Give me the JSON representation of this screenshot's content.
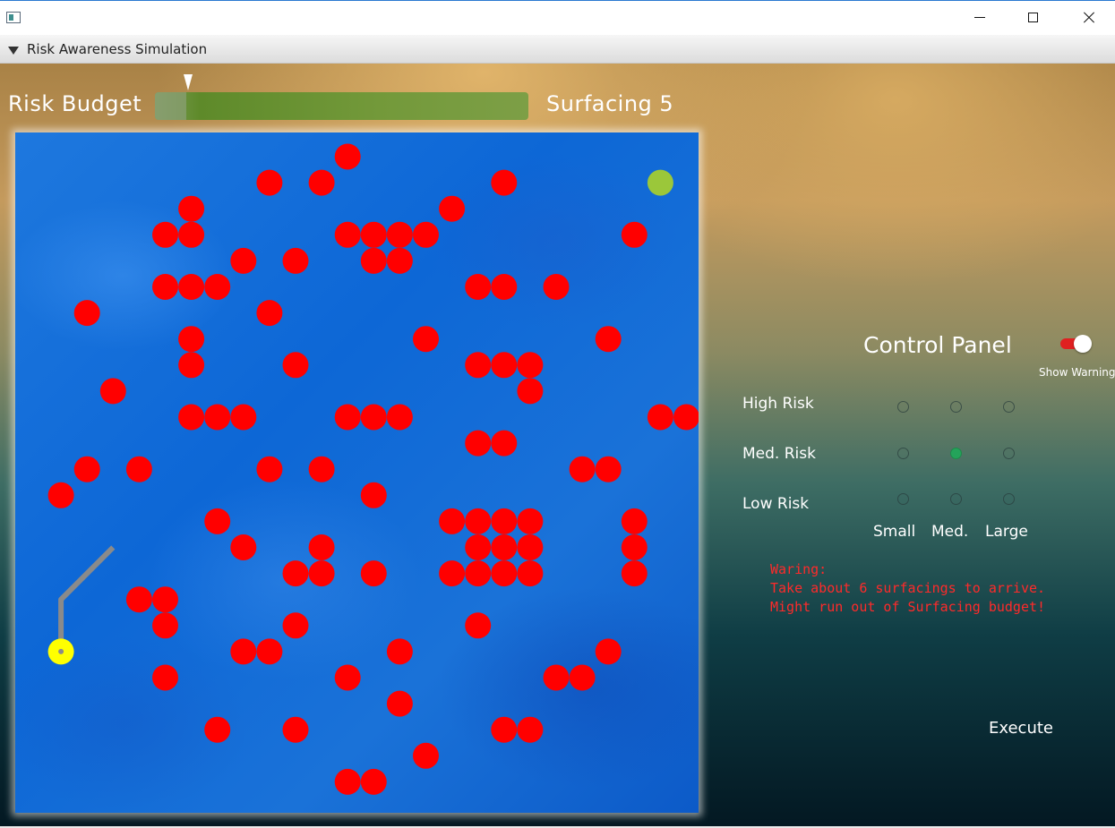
{
  "window": {
    "title": ""
  },
  "section": {
    "title": "Risk Awareness Simulation"
  },
  "header": {
    "budget_label": "Risk Budget",
    "surfacing_label": "Surfacing 5"
  },
  "colors": {
    "obstacle": "#ff0000",
    "goal": "#9bc73a",
    "start": "#ffff00",
    "path": "#8a8a8a",
    "warning": "#ff2a2a"
  },
  "map": {
    "obstacles": [
      [
        12,
        0
      ],
      [
        9,
        1
      ],
      [
        11,
        1
      ],
      [
        18,
        1
      ],
      [
        6,
        2
      ],
      [
        16,
        2
      ],
      [
        5,
        3
      ],
      [
        6,
        3
      ],
      [
        12,
        3
      ],
      [
        13,
        3
      ],
      [
        14,
        3
      ],
      [
        15,
        3
      ],
      [
        23,
        3
      ],
      [
        8,
        4
      ],
      [
        10,
        4
      ],
      [
        13,
        4
      ],
      [
        14,
        4
      ],
      [
        5,
        5
      ],
      [
        6,
        5
      ],
      [
        7,
        5
      ],
      [
        17,
        5
      ],
      [
        18,
        5
      ],
      [
        20,
        5
      ],
      [
        2,
        6
      ],
      [
        9,
        6
      ],
      [
        6,
        7
      ],
      [
        15,
        7
      ],
      [
        22,
        7
      ],
      [
        6,
        8
      ],
      [
        10,
        8
      ],
      [
        17,
        8
      ],
      [
        18,
        8
      ],
      [
        19,
        8
      ],
      [
        3,
        9
      ],
      [
        19,
        9
      ],
      [
        6,
        10
      ],
      [
        7,
        10
      ],
      [
        8,
        10
      ],
      [
        12,
        10
      ],
      [
        13,
        10
      ],
      [
        14,
        10
      ],
      [
        24,
        10
      ],
      [
        25,
        10
      ],
      [
        17,
        11
      ],
      [
        18,
        11
      ],
      [
        2,
        12
      ],
      [
        4,
        12
      ],
      [
        9,
        12
      ],
      [
        11,
        12
      ],
      [
        21,
        12
      ],
      [
        22,
        12
      ],
      [
        1,
        13
      ],
      [
        13,
        13
      ],
      [
        7,
        14
      ],
      [
        16,
        14
      ],
      [
        17,
        14
      ],
      [
        18,
        14
      ],
      [
        19,
        14
      ],
      [
        23,
        14
      ],
      [
        8,
        15
      ],
      [
        11,
        15
      ],
      [
        17,
        15
      ],
      [
        18,
        15
      ],
      [
        19,
        15
      ],
      [
        23,
        15
      ],
      [
        10,
        16
      ],
      [
        11,
        16
      ],
      [
        13,
        16
      ],
      [
        16,
        16
      ],
      [
        17,
        16
      ],
      [
        18,
        16
      ],
      [
        19,
        16
      ],
      [
        23,
        16
      ],
      [
        4,
        17
      ],
      [
        5,
        17
      ],
      [
        5,
        18
      ],
      [
        10,
        18
      ],
      [
        17,
        18
      ],
      [
        8,
        19
      ],
      [
        9,
        19
      ],
      [
        14,
        19
      ],
      [
        22,
        19
      ],
      [
        5,
        20
      ],
      [
        12,
        20
      ],
      [
        20,
        20
      ],
      [
        21,
        20
      ],
      [
        14,
        21
      ],
      [
        7,
        22
      ],
      [
        10,
        22
      ],
      [
        18,
        22
      ],
      [
        19,
        22
      ],
      [
        15,
        23
      ],
      [
        12,
        24
      ],
      [
        13,
        24
      ]
    ],
    "goal": [
      24,
      1
    ],
    "start": [
      1,
      19
    ],
    "path": [
      [
        1,
        19
      ],
      [
        1,
        17
      ],
      [
        3,
        15
      ]
    ]
  },
  "control_panel": {
    "title": "Control Panel",
    "toggle_label": "Show Warning",
    "toggle_on": true,
    "risk_rows": [
      "High Risk",
      "Med. Risk",
      "Low Risk"
    ],
    "size_columns": [
      "Small",
      "Med.",
      "Large"
    ],
    "selected": {
      "risk": "Med. Risk",
      "size": "Med."
    },
    "warning_text": "Waring:\nTake about 6 surfacings to arrive.\nMight run out of Surfacing budget!",
    "execute_label": "Execute"
  }
}
